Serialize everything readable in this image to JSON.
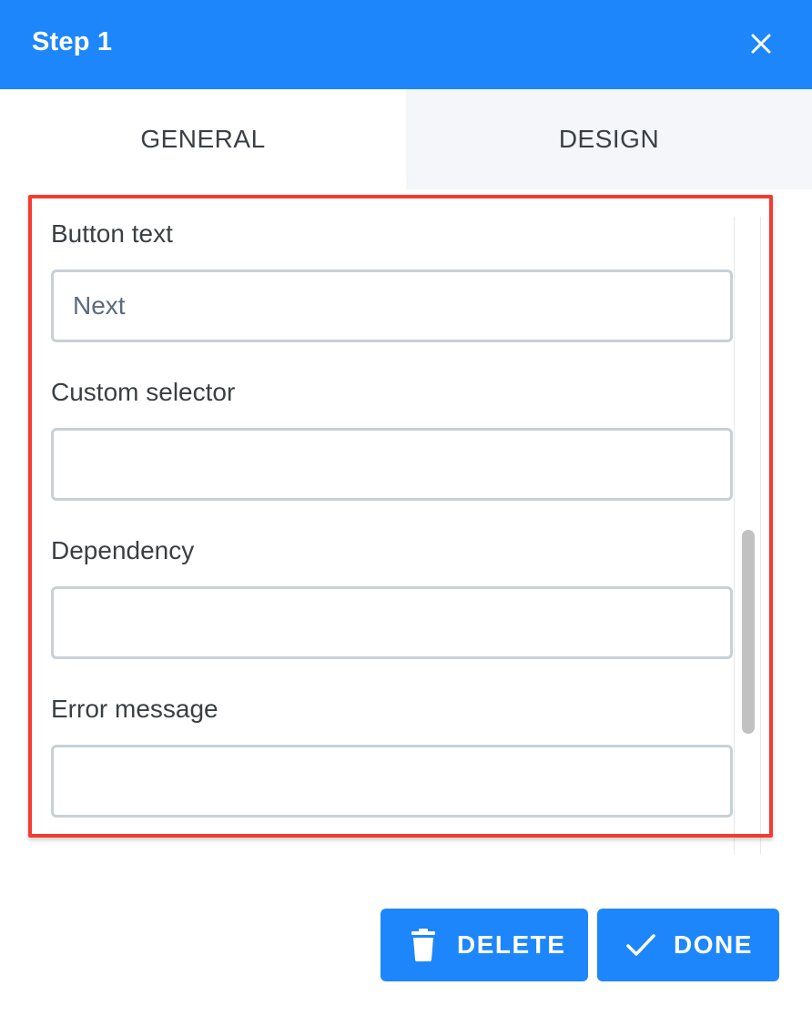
{
  "dialog": {
    "title": "Step 1",
    "close_icon": "close-icon"
  },
  "tabs": [
    {
      "label": "GENERAL",
      "active": true
    },
    {
      "label": "DESIGN",
      "active": false
    }
  ],
  "form": {
    "fields": [
      {
        "label": "Button text",
        "value": "Next",
        "placeholder": ""
      },
      {
        "label": "Custom selector",
        "value": "",
        "placeholder": ""
      },
      {
        "label": "Dependency",
        "value": "",
        "placeholder": ""
      },
      {
        "label": "Error message",
        "value": "",
        "placeholder": ""
      }
    ]
  },
  "footer": {
    "delete_label": "DELETE",
    "delete_icon": "trash-icon",
    "done_label": "DONE",
    "done_icon": "check-icon"
  },
  "colors": {
    "accent": "#1e86fb",
    "highlight": "#f53a2e",
    "inactive_tab_bg": "#f4f6f9",
    "input_border": "#c8d0d7"
  }
}
